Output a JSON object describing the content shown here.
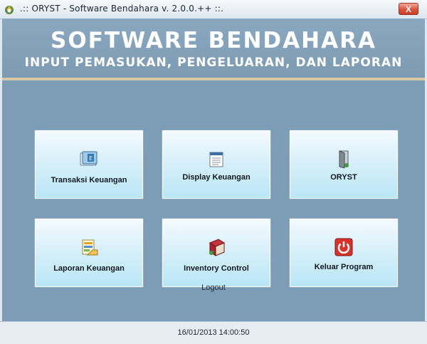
{
  "window": {
    "title": ".:: ORYST - Software Bendahara v. 2.0.0.++ ::.",
    "close_label": "X"
  },
  "header": {
    "title": "SOFTWARE BENDAHARA",
    "subtitle": "INPUT PEMASUKAN, PENGELUARAN, DAN LAPORAN"
  },
  "menu": {
    "transaksi": {
      "label": "Transaksi Keuangan",
      "icon": "book-icon"
    },
    "display": {
      "label": "Display Keuangan",
      "icon": "document-icon"
    },
    "oryst": {
      "label": "ORYST",
      "icon": "door-icon"
    },
    "laporan": {
      "label": "Laporan Keuangan",
      "icon": "report-icon"
    },
    "inventory": {
      "label": "Inventory Control",
      "icon": "ledger-icon"
    },
    "keluar": {
      "label": "Keluar Program",
      "icon": "power-icon"
    }
  },
  "logout_label": "Logout",
  "status": {
    "datetime": "16/01/2013 14:00:50"
  },
  "colors": {
    "background": "#7d9db6",
    "header_rule": "#d8c9a6",
    "tile_top": "#f4fbfe",
    "tile_bottom": "#b9e6f5",
    "close_button": "#d9543d"
  }
}
